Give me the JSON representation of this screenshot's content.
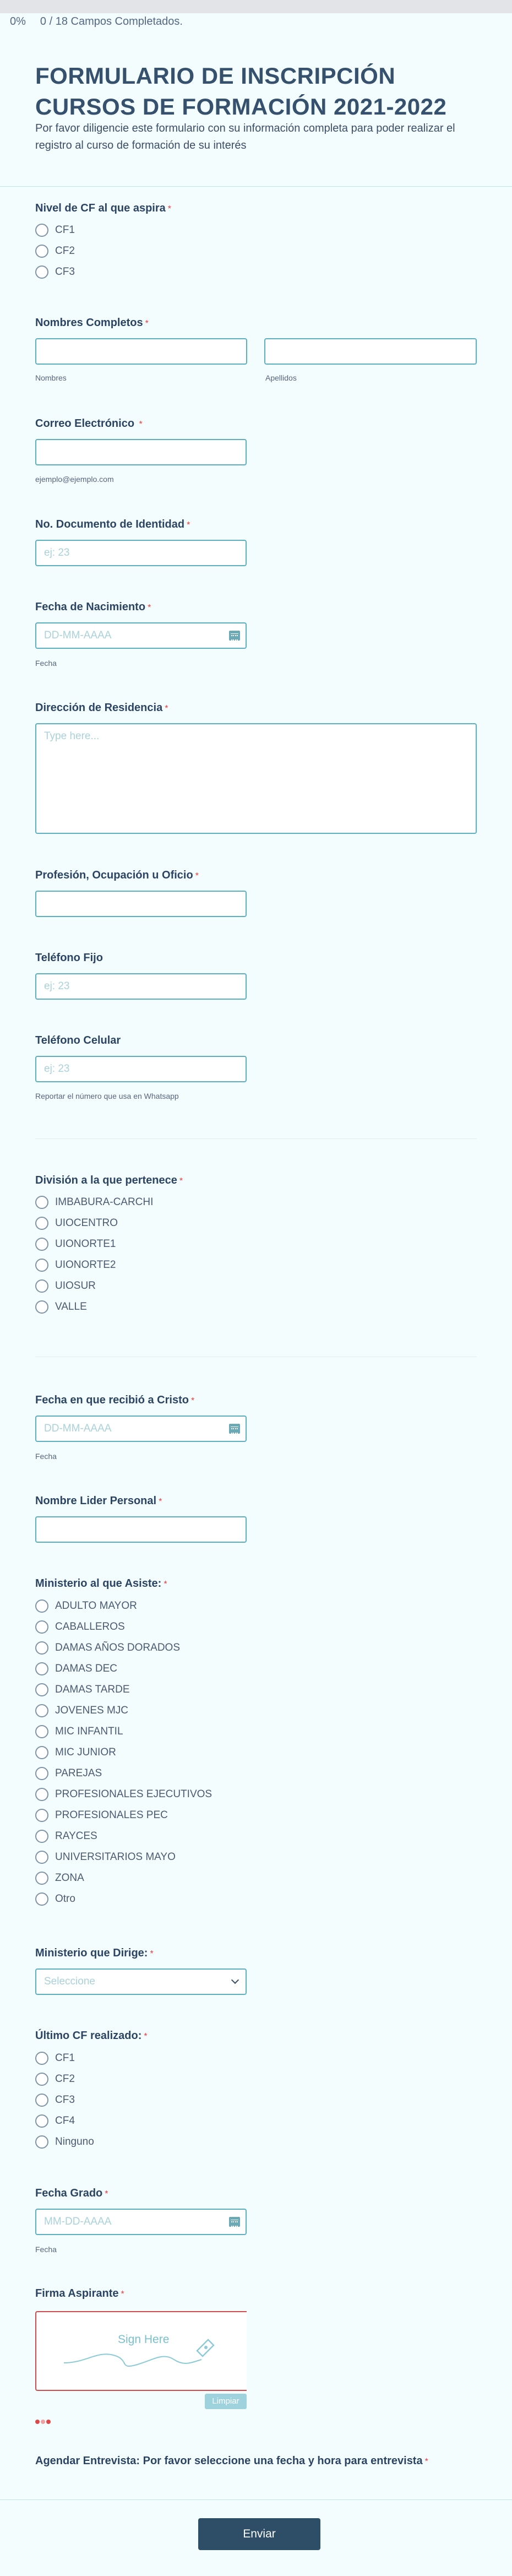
{
  "progress": {
    "percent_label": "0%",
    "fields_label": "0 / 18 Campos Completados."
  },
  "header": {
    "title": "FORMULARIO DE INSCRIPCIÓN CURSOS DE FORMACIÓN 2021-2022",
    "subtitle": "Por favor diligencie este formulario con su información completa para poder realizar el registro al curso de formación de su interés"
  },
  "required_mark": "*",
  "nivel": {
    "label": "Nivel de CF al que aspira",
    "options": [
      "CF1",
      "CF2",
      "CF3"
    ]
  },
  "nombres": {
    "label": "Nombres Completos",
    "first_sub": "Nombres",
    "last_sub": "Apellidos"
  },
  "correo": {
    "label": "Correo Electrónico",
    "sub": "ejemplo@ejemplo.com"
  },
  "documento": {
    "label": "No. Documento de Identidad",
    "placeholder": "ej: 23"
  },
  "nacimiento": {
    "label": "Fecha de Nacimiento",
    "placeholder": "DD-MM-AAAA",
    "sub": "Fecha"
  },
  "direccion": {
    "label": "Dirección de Residencia",
    "placeholder": "Type here..."
  },
  "profesion": {
    "label": "Profesión, Ocupación u Oficio"
  },
  "telefono_fijo": {
    "label": "Teléfono Fijo",
    "placeholder": "ej: 23"
  },
  "telefono_celular": {
    "label": "Teléfono Celular",
    "placeholder": "ej: 23",
    "sub": "Reportar el número que usa en Whatsapp"
  },
  "division": {
    "label": "División a la que pertenece",
    "options": [
      "IMBABURA-CARCHI",
      "UIOCENTRO",
      "UIONORTE1",
      "UIONORTE2",
      "UIOSUR",
      "VALLE"
    ]
  },
  "fecha_cristo": {
    "label": "Fecha en que recibió a Cristo",
    "placeholder": "DD-MM-AAAA",
    "sub": "Fecha"
  },
  "lider": {
    "label": "Nombre Lider Personal"
  },
  "ministerio_asiste": {
    "label": "Ministerio al que Asiste:",
    "options": [
      "ADULTO MAYOR",
      "CABALLEROS",
      "DAMAS AÑOS DORADOS",
      "DAMAS DEC",
      "DAMAS TARDE",
      "JOVENES MJC",
      "MIC INFANTIL",
      "MIC JUNIOR",
      "PAREJAS",
      "PROFESIONALES EJECUTIVOS",
      "PROFESIONALES PEC",
      "RAYCES",
      "UNIVERSITARIOS MAYO",
      "ZONA",
      "Otro"
    ]
  },
  "ministerio_dirige": {
    "label": "Ministerio que Dirige:",
    "placeholder": "Seleccione"
  },
  "ultimo_cf": {
    "label": "Último CF realizado:",
    "options": [
      "CF1",
      "CF2",
      "CF3",
      "CF4",
      "Ninguno"
    ]
  },
  "fecha_grado": {
    "label": "Fecha Grado",
    "placeholder": "MM-DD-AAAA",
    "sub": "Fecha"
  },
  "firma": {
    "label": "Firma Aspirante",
    "pad_text": "Sign Here",
    "clear_label": "Limpiar"
  },
  "entrevista": {
    "label": "Agendar Entrevista: Por favor seleccione una fecha y hora para entrevista"
  },
  "submit_label": "Enviar",
  "colors": {
    "accent_border": "#5ab0c0",
    "title": "#36516e",
    "required": "#f23a3c",
    "submit_bg": "#2d4e66",
    "page_bg": "#f3fdfe"
  }
}
